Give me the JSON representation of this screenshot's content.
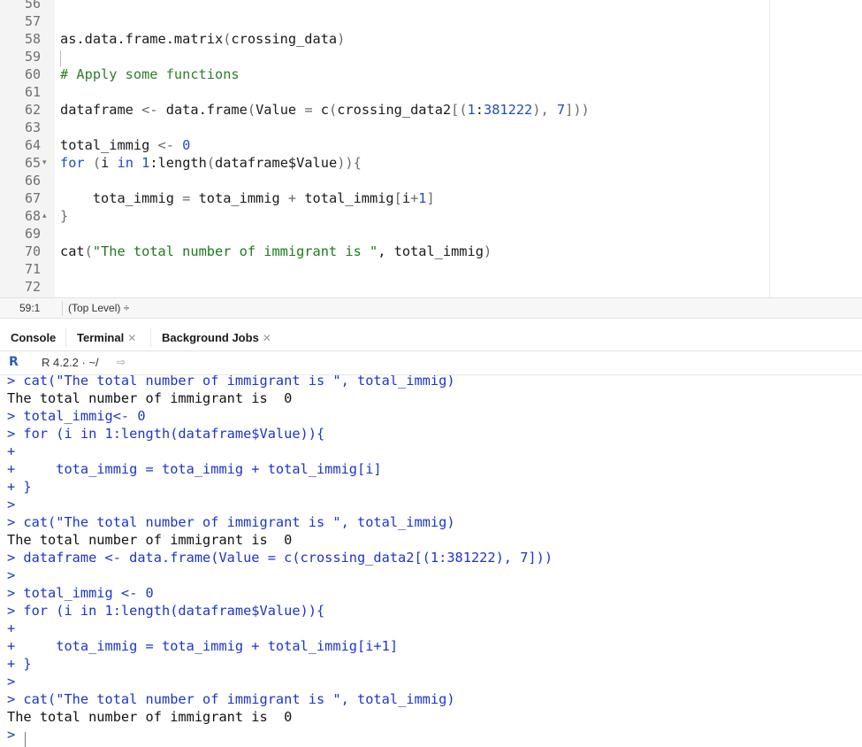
{
  "editor": {
    "lines": [
      {
        "n": "56",
        "fold": "",
        "tokens": []
      },
      {
        "n": "57",
        "fold": "",
        "tokens": []
      },
      {
        "n": "58",
        "fold": "",
        "tokens": [
          {
            "t": "as.data.frame.matrix",
            "c": "plain"
          },
          {
            "t": "(",
            "c": "br"
          },
          {
            "t": "crossing_data",
            "c": "plain"
          },
          {
            "t": ")",
            "c": "br"
          }
        ]
      },
      {
        "n": "59",
        "fold": "",
        "tokens": []
      },
      {
        "n": "60",
        "fold": "",
        "tokens": [
          {
            "t": "# Apply some functions",
            "c": "com"
          }
        ]
      },
      {
        "n": "61",
        "fold": "",
        "tokens": []
      },
      {
        "n": "62",
        "fold": "",
        "tokens": [
          {
            "t": "dataframe ",
            "c": "plain"
          },
          {
            "t": "<-",
            "c": "op"
          },
          {
            "t": " data.frame",
            "c": "plain"
          },
          {
            "t": "(",
            "c": "br"
          },
          {
            "t": "Value ",
            "c": "plain"
          },
          {
            "t": "=",
            "c": "op"
          },
          {
            "t": " c",
            "c": "plain"
          },
          {
            "t": "(",
            "c": "br"
          },
          {
            "t": "crossing_data2",
            "c": "plain"
          },
          {
            "t": "[(",
            "c": "br"
          },
          {
            "t": "1",
            "c": "num"
          },
          {
            "t": ":",
            "c": "plain"
          },
          {
            "t": "381222",
            "c": "num"
          },
          {
            "t": "), ",
            "c": "br"
          },
          {
            "t": "7",
            "c": "num"
          },
          {
            "t": "]))",
            "c": "br"
          }
        ]
      },
      {
        "n": "63",
        "fold": "",
        "tokens": []
      },
      {
        "n": "64",
        "fold": "",
        "tokens": [
          {
            "t": "total_immig ",
            "c": "plain"
          },
          {
            "t": "<-",
            "c": "op"
          },
          {
            "t": " ",
            "c": "plain"
          },
          {
            "t": "0",
            "c": "num"
          }
        ]
      },
      {
        "n": "65",
        "fold": "▾",
        "tokens": [
          {
            "t": "for",
            "c": "kw"
          },
          {
            "t": " ",
            "c": "plain"
          },
          {
            "t": "(",
            "c": "br"
          },
          {
            "t": "i ",
            "c": "plain"
          },
          {
            "t": "in",
            "c": "kw"
          },
          {
            "t": " ",
            "c": "plain"
          },
          {
            "t": "1",
            "c": "num"
          },
          {
            "t": ":length",
            "c": "plain"
          },
          {
            "t": "(",
            "c": "br"
          },
          {
            "t": "dataframe$Value",
            "c": "plain"
          },
          {
            "t": ")){",
            "c": "br"
          }
        ]
      },
      {
        "n": "66",
        "fold": "",
        "tokens": []
      },
      {
        "n": "67",
        "fold": "",
        "tokens": [
          {
            "t": "    tota_immig ",
            "c": "plain"
          },
          {
            "t": "=",
            "c": "op"
          },
          {
            "t": " tota_immig ",
            "c": "plain"
          },
          {
            "t": "+",
            "c": "op"
          },
          {
            "t": " total_immig",
            "c": "plain"
          },
          {
            "t": "[",
            "c": "br"
          },
          {
            "t": "i",
            "c": "plain"
          },
          {
            "t": "+",
            "c": "op"
          },
          {
            "t": "1",
            "c": "num"
          },
          {
            "t": "]",
            "c": "br"
          }
        ]
      },
      {
        "n": "68",
        "fold": "▴",
        "tokens": [
          {
            "t": "}",
            "c": "br"
          }
        ]
      },
      {
        "n": "69",
        "fold": "",
        "tokens": []
      },
      {
        "n": "70",
        "fold": "",
        "tokens": [
          {
            "t": "cat",
            "c": "plain"
          },
          {
            "t": "(",
            "c": "br"
          },
          {
            "t": "\"The total number of immigrant is \"",
            "c": "str"
          },
          {
            "t": ", total_immig",
            "c": "plain"
          },
          {
            "t": ")",
            "c": "br"
          }
        ]
      },
      {
        "n": "71",
        "fold": "",
        "tokens": []
      },
      {
        "n": "72",
        "fold": "",
        "tokens": []
      }
    ]
  },
  "status": {
    "position": "59:1",
    "scope": "(Top Level) ÷"
  },
  "tabs": [
    {
      "label": "Console",
      "closable": false
    },
    {
      "label": "Terminal",
      "closable": true
    },
    {
      "label": "Background Jobs",
      "closable": true
    }
  ],
  "console_header": {
    "r_logo": "R",
    "version": "R 4.2.2 · ~/"
  },
  "console": {
    "lines": [
      {
        "text": "> cat(\"The total number of immigrant is \", total_immig)",
        "kind": "in"
      },
      {
        "text": "The total number of immigrant is  0",
        "kind": "out"
      },
      {
        "text": "> total_immig<- 0",
        "kind": "in"
      },
      {
        "text": "> for (i in 1:length(dataframe$Value)){",
        "kind": "in"
      },
      {
        "text": "+ ",
        "kind": "in"
      },
      {
        "text": "+     tota_immig = tota_immig + total_immig[i]",
        "kind": "in"
      },
      {
        "text": "+ }",
        "kind": "in"
      },
      {
        "text": "> ",
        "kind": "in"
      },
      {
        "text": "> cat(\"The total number of immigrant is \", total_immig)",
        "kind": "in"
      },
      {
        "text": "The total number of immigrant is  0",
        "kind": "out"
      },
      {
        "text": "> dataframe <- data.frame(Value = c(crossing_data2[(1:381222), 7]))",
        "kind": "in"
      },
      {
        "text": "> ",
        "kind": "in"
      },
      {
        "text": "> total_immig <- 0",
        "kind": "in"
      },
      {
        "text": "> for (i in 1:length(dataframe$Value)){",
        "kind": "in"
      },
      {
        "text": "+ ",
        "kind": "in"
      },
      {
        "text": "+     tota_immig = tota_immig + total_immig[i+1]",
        "kind": "in"
      },
      {
        "text": "+ }",
        "kind": "in"
      },
      {
        "text": "> ",
        "kind": "in"
      },
      {
        "text": "> cat(\"The total number of immigrant is \", total_immig)",
        "kind": "in"
      },
      {
        "text": "The total number of immigrant is  0",
        "kind": "out"
      },
      {
        "text": "> ",
        "kind": "in"
      }
    ]
  }
}
